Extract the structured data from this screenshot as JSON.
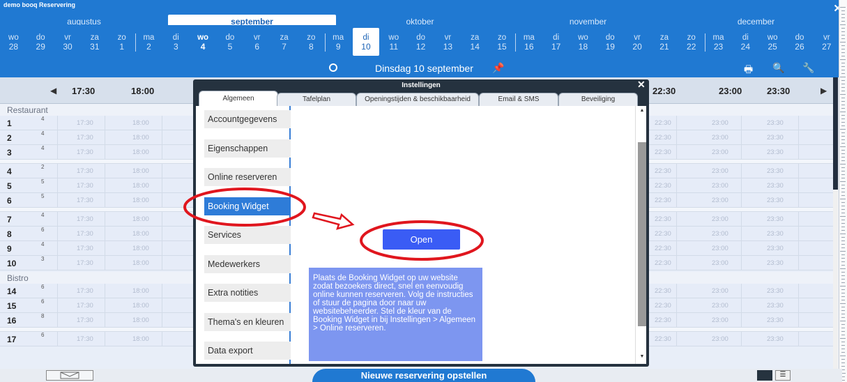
{
  "app": {
    "title": "demo booq Reservering",
    "close": "✕"
  },
  "months": [
    "augustus",
    "september",
    "oktober",
    "november",
    "december"
  ],
  "active_month": "september",
  "days": [
    {
      "d": "wo",
      "n": "28"
    },
    {
      "d": "do",
      "n": "29"
    },
    {
      "d": "vr",
      "n": "30"
    },
    {
      "d": "za",
      "n": "31"
    },
    {
      "d": "zo",
      "n": "1"
    },
    {
      "d": "ma",
      "n": "2"
    },
    {
      "d": "di",
      "n": "3"
    },
    {
      "d": "wo",
      "n": "4"
    },
    {
      "d": "do",
      "n": "5"
    },
    {
      "d": "vr",
      "n": "6"
    },
    {
      "d": "za",
      "n": "7"
    },
    {
      "d": "zo",
      "n": "8"
    },
    {
      "d": "ma",
      "n": "9"
    },
    {
      "d": "di",
      "n": "10"
    },
    {
      "d": "wo",
      "n": "11"
    },
    {
      "d": "do",
      "n": "12"
    },
    {
      "d": "vr",
      "n": "13"
    },
    {
      "d": "za",
      "n": "14"
    },
    {
      "d": "zo",
      "n": "15"
    },
    {
      "d": "ma",
      "n": "16"
    },
    {
      "d": "di",
      "n": "17"
    },
    {
      "d": "wo",
      "n": "18"
    },
    {
      "d": "do",
      "n": "19"
    },
    {
      "d": "vr",
      "n": "20"
    },
    {
      "d": "za",
      "n": "21"
    },
    {
      "d": "zo",
      "n": "22"
    },
    {
      "d": "ma",
      "n": "23"
    },
    {
      "d": "di",
      "n": "24"
    },
    {
      "d": "wo",
      "n": "25"
    },
    {
      "d": "do",
      "n": "26"
    },
    {
      "d": "vr",
      "n": "27"
    }
  ],
  "today_index": 7,
  "selected_index": 13,
  "nav": {
    "date": "Dinsdag 10 september"
  },
  "times_left": [
    "17:30",
    "18:00"
  ],
  "times_right": [
    "22:30",
    "23:00",
    "23:30"
  ],
  "sections": [
    {
      "name": "Restaurant",
      "groups": [
        [
          {
            "t": "1",
            "c": "4"
          },
          {
            "t": "2",
            "c": "4"
          },
          {
            "t": "3",
            "c": "4"
          }
        ],
        [
          {
            "t": "4",
            "c": "2"
          },
          {
            "t": "5",
            "c": "5"
          },
          {
            "t": "6",
            "c": "5"
          }
        ],
        [
          {
            "t": "7",
            "c": "4"
          },
          {
            "t": "8",
            "c": "6"
          },
          {
            "t": "9",
            "c": "4"
          },
          {
            "t": "10",
            "c": "3"
          }
        ]
      ]
    },
    {
      "name": "Bistro",
      "groups": [
        [
          {
            "t": "14",
            "c": "6"
          },
          {
            "t": "15",
            "c": "6"
          },
          {
            "t": "16",
            "c": "8"
          }
        ],
        [
          {
            "t": "17",
            "c": "6"
          }
        ]
      ]
    }
  ],
  "dialog": {
    "title": "Instellingen",
    "close": "✕",
    "tabs": [
      "Algemeen",
      "Tafelplan",
      "Openingstijden & beschikbaarheid",
      "Email & SMS",
      "Beveiliging"
    ],
    "active_tab": 0,
    "nav": [
      "Accountgegevens",
      "Eigenschappen",
      "Online reserveren",
      "Booking Widget",
      "Services",
      "Medewerkers",
      "Extra notities",
      "Thema's en kleuren",
      "Data export"
    ],
    "active_nav": 3,
    "open_button": "Open",
    "info": "Plaats de Booking Widget op uw website zodat bezoekers direct, snel en eenvoudig online kunnen reserveren. Volg de instructies of stuur de pagina door naar uw websitebeheerder. Stel de kleur van de Booking Widget in bij Instellingen > Algemeen > Online reserveren."
  },
  "bottom": {
    "new_reservation": "Nieuwe reservering opstellen"
  },
  "colors": {
    "primary": "#2079d2",
    "dialog": "#25323f",
    "accent": "#2e7cd8",
    "button": "#3a5cf5",
    "info_bg": "#7d96f0",
    "annotation": "#e0161e"
  }
}
